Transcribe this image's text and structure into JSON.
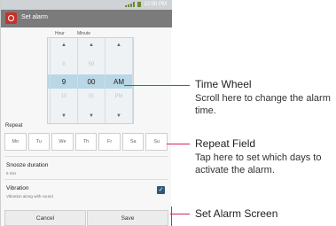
{
  "status": {
    "time": "12:00 PM"
  },
  "titlebar": {
    "title": "Set alarm",
    "icon": "alarm-clock-icon"
  },
  "wheel": {
    "headers": {
      "hour": "Hour",
      "minute": "Minute"
    },
    "up_glyph": "▲",
    "down_glyph": "▼",
    "hour": {
      "prev": "8",
      "selected": "9",
      "next": "10"
    },
    "minute": {
      "prev": "59",
      "selected": "00",
      "next": "01"
    },
    "ampm": {
      "prev": "",
      "selected": "AM",
      "next": "PM"
    }
  },
  "repeat": {
    "label": "Repeat",
    "days": [
      "Mo",
      "Tu",
      "We",
      "Th",
      "Fr",
      "Sa",
      "Su"
    ]
  },
  "snooze": {
    "title": "Snooze duration",
    "value": "5 min"
  },
  "vibration": {
    "title": "Vibration",
    "subtitle": "Vibration along with sound",
    "checked": true
  },
  "buttons": {
    "cancel": "Cancel",
    "save": "Save"
  },
  "callouts": [
    {
      "title": "Time Wheel",
      "desc": "Scroll here to change the alarm time."
    },
    {
      "title": "Repeat Field",
      "desc": "Tap here to set which days to activate the alarm."
    },
    {
      "title": "Set Alarm Screen",
      "desc": ""
    }
  ],
  "accent_color": "#d6225f"
}
